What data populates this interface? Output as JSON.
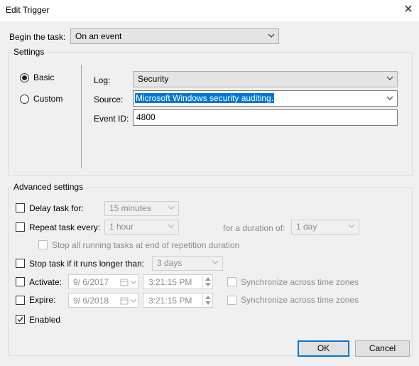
{
  "window": {
    "title": "Edit Trigger",
    "close_glyph": "✕"
  },
  "begin": {
    "label": "Begin the task:",
    "value": "On an event"
  },
  "settings": {
    "group_label": "Settings",
    "basic_label": "Basic",
    "custom_label": "Custom",
    "log_label": "Log:",
    "log_value": "Security",
    "source_label": "Source:",
    "source_value": "Microsoft Windows security auditing.",
    "eventid_label": "Event ID:",
    "eventid_value": "4800"
  },
  "advanced": {
    "group_label": "Advanced settings",
    "delay_label": "Delay task for:",
    "delay_value": "15 minutes",
    "repeat_label": "Repeat task every:",
    "repeat_value": "1 hour",
    "duration_label": "for a duration of:",
    "duration_value": "1 day",
    "stop_all_label": "Stop all running tasks at end of repetition duration",
    "stop_longer_label": "Stop task if it runs longer than:",
    "stop_longer_value": "3 days",
    "activate_label": "Activate:",
    "activate_date": "9/ 6/2017",
    "activate_time": "3:21:15 PM",
    "expire_label": "Expire:",
    "expire_date": "9/ 6/2018",
    "expire_time": "3:21:15 PM",
    "sync_label": "Synchronize across time zones",
    "enabled_label": "Enabled",
    "enabled_checked": true
  },
  "buttons": {
    "ok": "OK",
    "cancel": "Cancel"
  },
  "colors": {
    "accent": "#0078d7",
    "dialog_bg": "#f0f0f0"
  }
}
